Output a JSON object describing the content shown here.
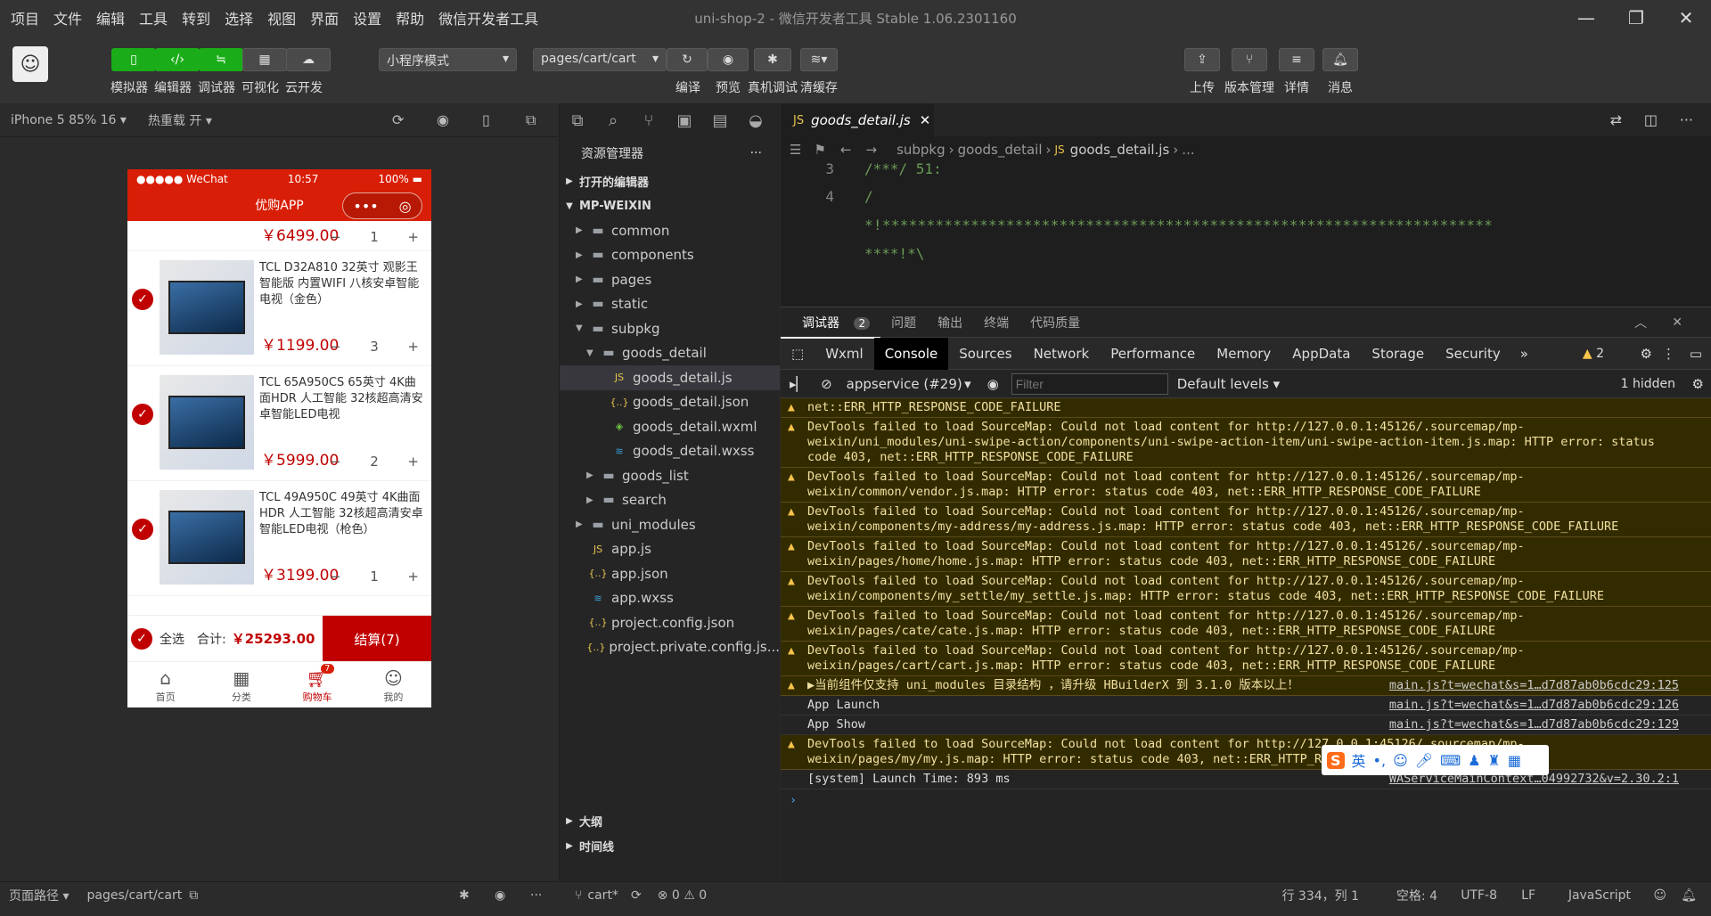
{
  "menu": [
    "项目",
    "文件",
    "编辑",
    "工具",
    "转到",
    "选择",
    "视图",
    "界面",
    "设置",
    "帮助",
    "微信开发者工具"
  ],
  "window_title": "uni-shop-2 - 微信开发者工具 Stable 1.06.2301160",
  "toolbar": {
    "simulator": "模拟器",
    "editor": "编辑器",
    "debugger": "调试器",
    "visual": "可视化",
    "cloud": "云开发",
    "mode": "小程序模式",
    "page": "pages/cart/cart",
    "compile": "编译",
    "preview": "预览",
    "remote_debug": "真机调试",
    "clear_cache": "清缓存",
    "upload": "上传",
    "version": "版本管理",
    "details": "详情",
    "messages": "消息"
  },
  "sim": {
    "device": "iPhone 5 85% 16",
    "hot_reload": "热重载 开",
    "path_label": "页面路径",
    "path": "pages/cart/cart"
  },
  "phone": {
    "carrier": "●●●●● WeChat",
    "time": "10:57",
    "battery": "100%",
    "nav_title": "优购APP",
    "first_price": "￥6499.00",
    "first_qty": "1",
    "items": [
      {
        "name": "TCL D32A810 32英寸 观影王 智能版 内置WIFI 八核安卓智能电视（金色）",
        "price": "￥1199.00",
        "qty": "3"
      },
      {
        "name": "TCL 65A950CS 65英寸 4K曲面HDR 人工智能 32核超高清安卓智能LED电视",
        "price": "￥5999.00",
        "qty": "2"
      },
      {
        "name": "TCL 49A950C 49英寸 4K曲面HDR 人工智能 32核超高清安卓智能LED电视（枪色）",
        "price": "￥3199.00",
        "qty": "1"
      }
    ],
    "select_all": "全选",
    "total_label": "合计:",
    "total": "￥25293.00",
    "settle": "结算(7)",
    "tabs": [
      "首页",
      "分类",
      "购物车",
      "我的"
    ],
    "cart_badge": "7"
  },
  "explorer": {
    "title": "资源管理器",
    "open_editors": "打开的编辑器",
    "root": "MP-WEIXIN",
    "tree": [
      {
        "l": "common",
        "d": 1,
        "t": "folder",
        "a": "▶"
      },
      {
        "l": "components",
        "d": 1,
        "t": "folder",
        "a": "▶"
      },
      {
        "l": "pages",
        "d": 1,
        "t": "folder",
        "a": "▶"
      },
      {
        "l": "static",
        "d": 1,
        "t": "folder",
        "a": "▶"
      },
      {
        "l": "subpkg",
        "d": 1,
        "t": "folder",
        "a": "▼"
      },
      {
        "l": "goods_detail",
        "d": 2,
        "t": "folder",
        "a": "▼"
      },
      {
        "l": "goods_detail.js",
        "d": 3,
        "t": "js",
        "a": ""
      },
      {
        "l": "goods_detail.json",
        "d": 3,
        "t": "json",
        "a": ""
      },
      {
        "l": "goods_detail.wxml",
        "d": 3,
        "t": "wxml",
        "a": ""
      },
      {
        "l": "goods_detail.wxss",
        "d": 3,
        "t": "wxss",
        "a": ""
      },
      {
        "l": "goods_list",
        "d": 2,
        "t": "folder",
        "a": "▶"
      },
      {
        "l": "search",
        "d": 2,
        "t": "folder",
        "a": "▶"
      },
      {
        "l": "uni_modules",
        "d": 1,
        "t": "folder",
        "a": "▶"
      },
      {
        "l": "app.js",
        "d": 1,
        "t": "js",
        "a": ""
      },
      {
        "l": "app.json",
        "d": 1,
        "t": "json",
        "a": ""
      },
      {
        "l": "app.wxss",
        "d": 1,
        "t": "wxss",
        "a": ""
      },
      {
        "l": "project.config.json",
        "d": 1,
        "t": "json",
        "a": ""
      },
      {
        "l": "project.private.config.js...",
        "d": 1,
        "t": "json",
        "a": ""
      }
    ],
    "outline": "大纲",
    "timeline": "时间线"
  },
  "editor": {
    "tab": "goods_detail.js",
    "crumb": [
      "subpkg",
      "goods_detail",
      "goods_detail.js",
      "..."
    ],
    "lines": [
      {
        "n": "3",
        "t": "/***/ 51:"
      },
      {
        "n": "4",
        "t": "/"
      },
      {
        "n": "",
        "t": "*!*********************************************************************"
      },
      {
        "n": "",
        "t": "****!*\\"
      }
    ]
  },
  "debugger": {
    "tabs": [
      "调试器",
      "问题",
      "输出",
      "终端",
      "代码质量"
    ],
    "count": "2",
    "devtabs": [
      "Wxml",
      "Console",
      "Sources",
      "Network",
      "Performance",
      "Memory",
      "AppData",
      "Storage",
      "Security"
    ],
    "warn_count": "2",
    "context": "appservice (#29)",
    "filter": "Filter",
    "levels": "Default levels",
    "hidden": "1 hidden",
    "messages": [
      {
        "k": "warn",
        "t": "net::ERR_HTTP_RESPONSE_CODE_FAILURE",
        "s": ""
      },
      {
        "k": "warn",
        "t": "DevTools failed to load SourceMap: Could not load content for http://127.0.0.1:45126/.sourcemap/mp-weixin/uni_modules/uni-swipe-action/components/uni-swipe-action-item/uni-swipe-action-item.js.map: HTTP error: status code 403, net::ERR_HTTP_RESPONSE_CODE_FAILURE",
        "s": ""
      },
      {
        "k": "warn",
        "t": "DevTools failed to load SourceMap: Could not load content for http://127.0.0.1:45126/.sourcemap/mp-weixin/common/vendor.js.map: HTTP error: status code 403, net::ERR_HTTP_RESPONSE_CODE_FAILURE",
        "s": ""
      },
      {
        "k": "warn",
        "t": "DevTools failed to load SourceMap: Could not load content for http://127.0.0.1:45126/.sourcemap/mp-weixin/components/my-address/my-address.js.map: HTTP error: status code 403, net::ERR_HTTP_RESPONSE_CODE_FAILURE",
        "s": ""
      },
      {
        "k": "warn",
        "t": "DevTools failed to load SourceMap: Could not load content for http://127.0.0.1:45126/.sourcemap/mp-weixin/pages/home/home.js.map: HTTP error: status code 403, net::ERR_HTTP_RESPONSE_CODE_FAILURE",
        "s": ""
      },
      {
        "k": "warn",
        "t": "DevTools failed to load SourceMap: Could not load content for http://127.0.0.1:45126/.sourcemap/mp-weixin/components/my_settle/my_settle.js.map: HTTP error: status code 403, net::ERR_HTTP_RESPONSE_CODE_FAILURE",
        "s": ""
      },
      {
        "k": "warn",
        "t": "DevTools failed to load SourceMap: Could not load content for http://127.0.0.1:45126/.sourcemap/mp-weixin/pages/cate/cate.js.map: HTTP error: status code 403, net::ERR_HTTP_RESPONSE_CODE_FAILURE",
        "s": ""
      },
      {
        "k": "warn",
        "t": "DevTools failed to load SourceMap: Could not load content for http://127.0.0.1:45126/.sourcemap/mp-weixin/pages/cart/cart.js.map: HTTP error: status code 403, net::ERR_HTTP_RESPONSE_CODE_FAILURE",
        "s": ""
      },
      {
        "k": "warn",
        "t": "▶当前组件仅支持 uni_modules 目录结构 ，请升级 HBuilderX 到 3.1.0 版本以上！",
        "s": "main.js?t=wechat&s=1…d7d87ab0b6cdc29:125"
      },
      {
        "k": "info",
        "t": "App Launch",
        "s": "main.js?t=wechat&s=1…d7d87ab0b6cdc29:126"
      },
      {
        "k": "info",
        "t": "App Show",
        "s": "main.js?t=wechat&s=1…d7d87ab0b6cdc29:129"
      },
      {
        "k": "warn",
        "t": "DevTools failed to load SourceMap: Could not load content for http://127.0.0.1:45126/.sourcemap/mp-weixin/pages/my/my.js.map: HTTP error: status code 403, net::ERR_HTTP_RESPONSE_CODE_FAILURE",
        "s": ""
      },
      {
        "k": "info",
        "t": "[system] Launch Time: 893 ms",
        "s": "WAServiceMainContext…04992732&v=2.30.2:1"
      }
    ]
  },
  "status": {
    "branch": "cart*",
    "errors": "0",
    "warnings": "0",
    "position": "行 334，列 1",
    "spaces": "空格: 4",
    "encoding": "UTF-8",
    "eol": "LF",
    "lang": "JavaScript"
  },
  "ime": {
    "lang": "英"
  }
}
